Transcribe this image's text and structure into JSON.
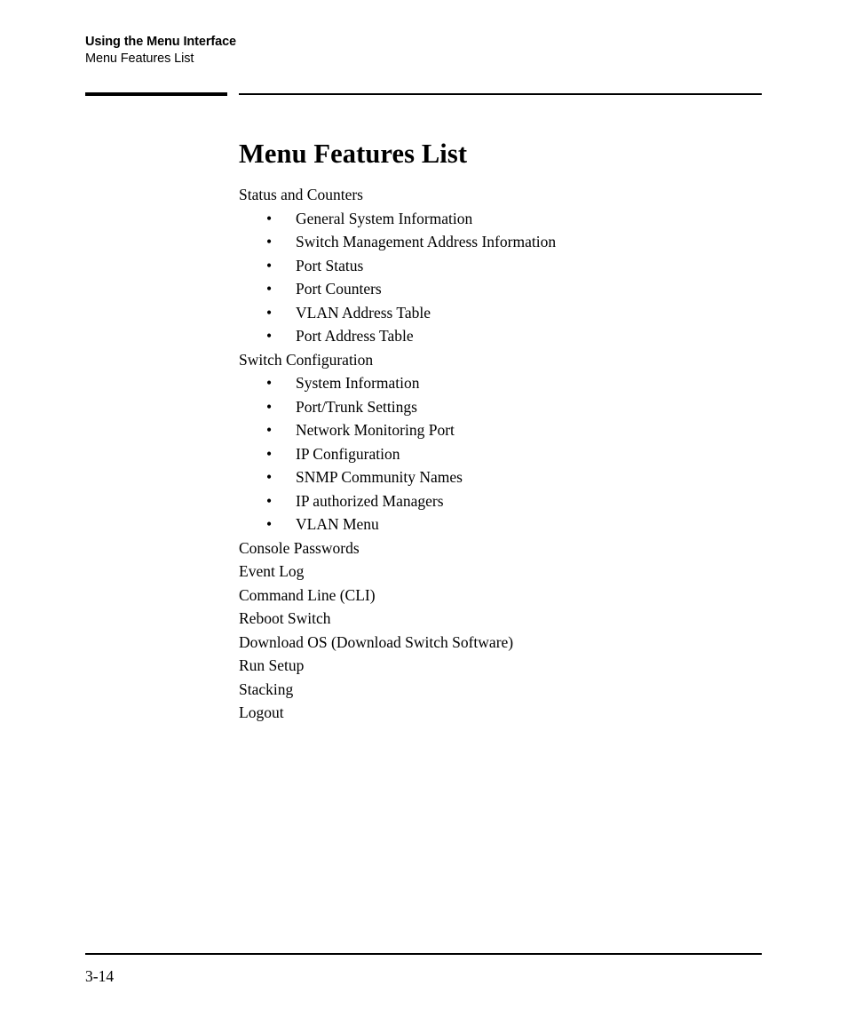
{
  "header": {
    "chapter_title": "Using the Menu Interface",
    "section_subtitle": "Menu Features List"
  },
  "title": "Menu Features List",
  "bullet_glyph": "•",
  "menu": {
    "entries": [
      {
        "label": "Status and Counters",
        "children": [
          "General System Information",
          "Switch Management Address Information",
          "Port Status",
          "Port Counters",
          "VLAN Address Table",
          "Port Address Table"
        ]
      },
      {
        "label": "Switch Configuration",
        "children": [
          "System Information",
          "Port/Trunk Settings",
          "Network Monitoring Port",
          "IP Configuration",
          "SNMP Community Names",
          "IP authorized Managers",
          "VLAN Menu"
        ]
      },
      {
        "label": "Console Passwords",
        "children": []
      },
      {
        "label": "Event Log",
        "children": []
      },
      {
        "label": "Command Line (CLI)",
        "children": []
      },
      {
        "label": "Reboot Switch",
        "children": []
      },
      {
        "label": "Download OS (Download Switch Software)",
        "children": []
      },
      {
        "label": "Run Setup",
        "children": []
      },
      {
        "label": "Stacking",
        "children": []
      },
      {
        "label": "Logout",
        "children": []
      }
    ]
  },
  "footer": {
    "page_number": "3-14"
  }
}
